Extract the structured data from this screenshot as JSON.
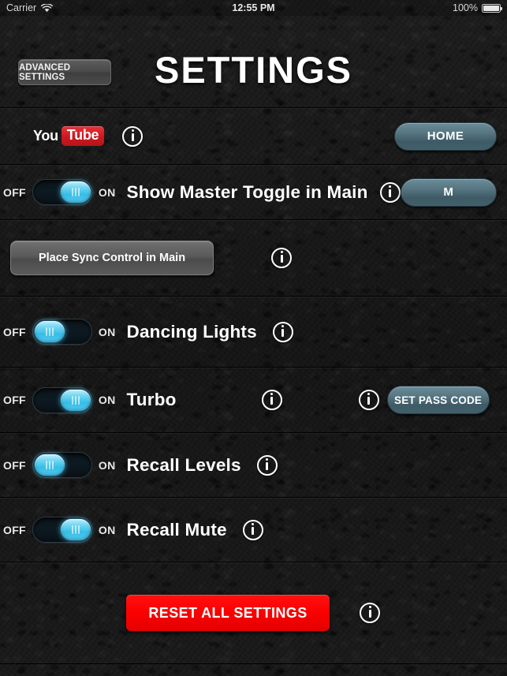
{
  "status_bar": {
    "carrier": "Carrier",
    "wifi_icon": "wifi-icon",
    "time": "12:55 PM",
    "battery_percent": "100%",
    "battery_icon": "battery-full-icon"
  },
  "header": {
    "advanced_settings_label": "ADVANCED SETTINGS",
    "title": "SETTINGS"
  },
  "rows": {
    "youtube": {
      "logo_you": "You",
      "logo_tube": "Tube",
      "info_icon": "info-icon",
      "home_button": "HOME"
    },
    "master_toggle": {
      "off_label": "OFF",
      "on_label": "ON",
      "state": "on",
      "label": "Show Master Toggle in Main",
      "info_icon": "info-icon",
      "m_button": "M"
    },
    "sync_control": {
      "button_label": "Place Sync Control in Main",
      "info_icon": "info-icon"
    },
    "dancing_lights": {
      "off_label": "OFF",
      "on_label": "ON",
      "state": "off",
      "label": "Dancing Lights",
      "info_icon": "info-icon"
    },
    "turbo": {
      "off_label": "OFF",
      "on_label": "ON",
      "state": "on",
      "label": "Turbo",
      "info_icon": "info-icon",
      "info_icon_2": "info-icon",
      "pass_code_button": "SET PASS CODE"
    },
    "recall_levels": {
      "off_label": "OFF",
      "on_label": "ON",
      "state": "off",
      "label": "Recall Levels",
      "info_icon": "info-icon"
    },
    "recall_mute": {
      "off_label": "OFF",
      "on_label": "ON",
      "state": "on",
      "label": "Recall Mute",
      "info_icon": "info-icon"
    },
    "reset": {
      "button_label": "RESET ALL SETTINGS",
      "info_icon": "info-icon"
    }
  },
  "colors": {
    "accent_cyan": "#57cbef",
    "slate_button": "#54737f",
    "danger_red": "#fb0000",
    "youtube_red": "#cc181e",
    "background": "#1b1b1b"
  }
}
